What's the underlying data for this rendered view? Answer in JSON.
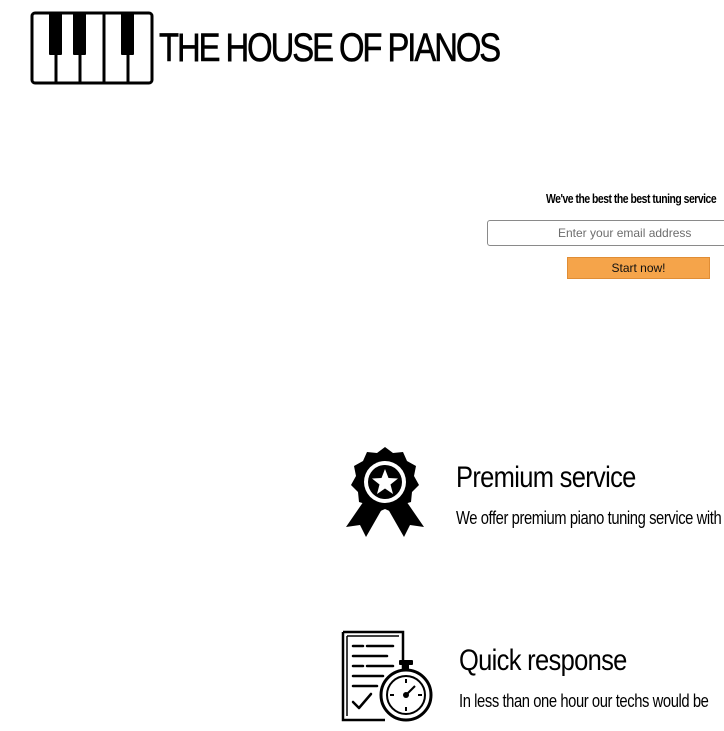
{
  "brand": {
    "name": "THE HOUSE OF PIANOS",
    "logo_icon": "piano-keys-icon"
  },
  "signup": {
    "tagline": "We've the best the best tuning service",
    "email_placeholder": "Enter your email address",
    "email_value": "",
    "cta_label": "Start now!",
    "cta_color": "#f5a44a"
  },
  "features": [
    {
      "icon": "award-ribbon-icon",
      "title": "Premium service",
      "description": "We offer premium piano tuning service with"
    },
    {
      "icon": "checklist-stopwatch-icon",
      "title": "Quick response",
      "description": "In less than one hour our techs would be"
    }
  ]
}
